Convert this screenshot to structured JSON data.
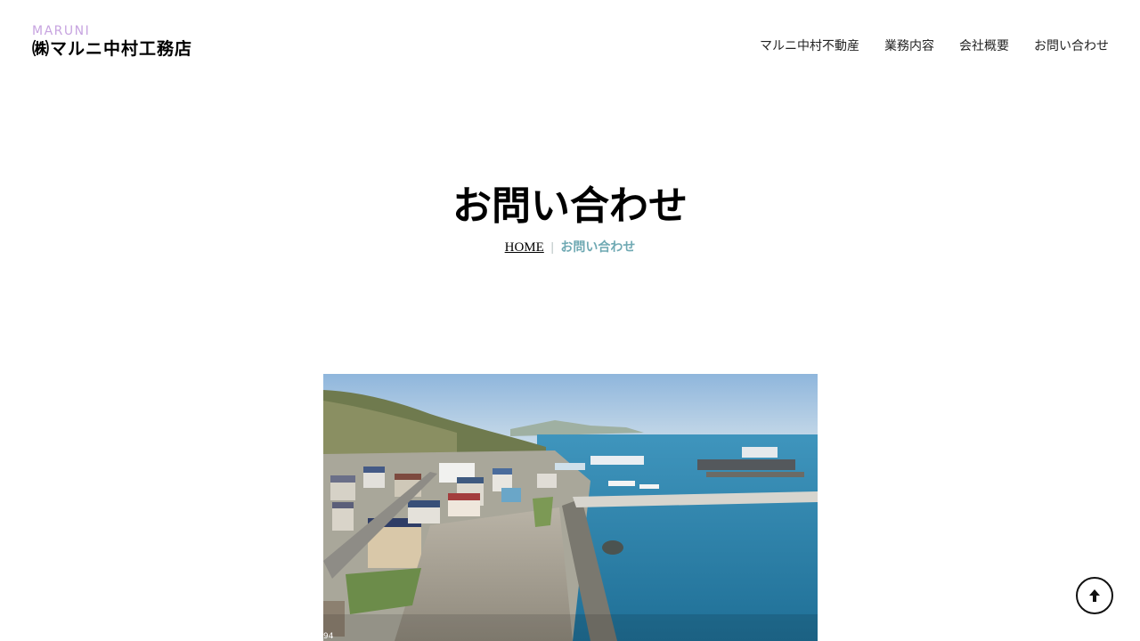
{
  "header": {
    "logo_sub": "MARUNI",
    "logo_main": "㈱マルニ中村工務店",
    "nav": [
      "マルニ中村不動産",
      "業務内容",
      "会社概要",
      "お問い合わせ"
    ]
  },
  "page": {
    "title": "お問い合わせ",
    "breadcrumb": {
      "home": "HOME",
      "separator": "|",
      "current": "お問い合わせ"
    }
  },
  "photo": {
    "corner_label": "94"
  },
  "back_to_top": {
    "icon": "arrow-up-icon"
  },
  "colors": {
    "accent": "#6fa9b3",
    "logo_sub": "#c7a4e0"
  }
}
